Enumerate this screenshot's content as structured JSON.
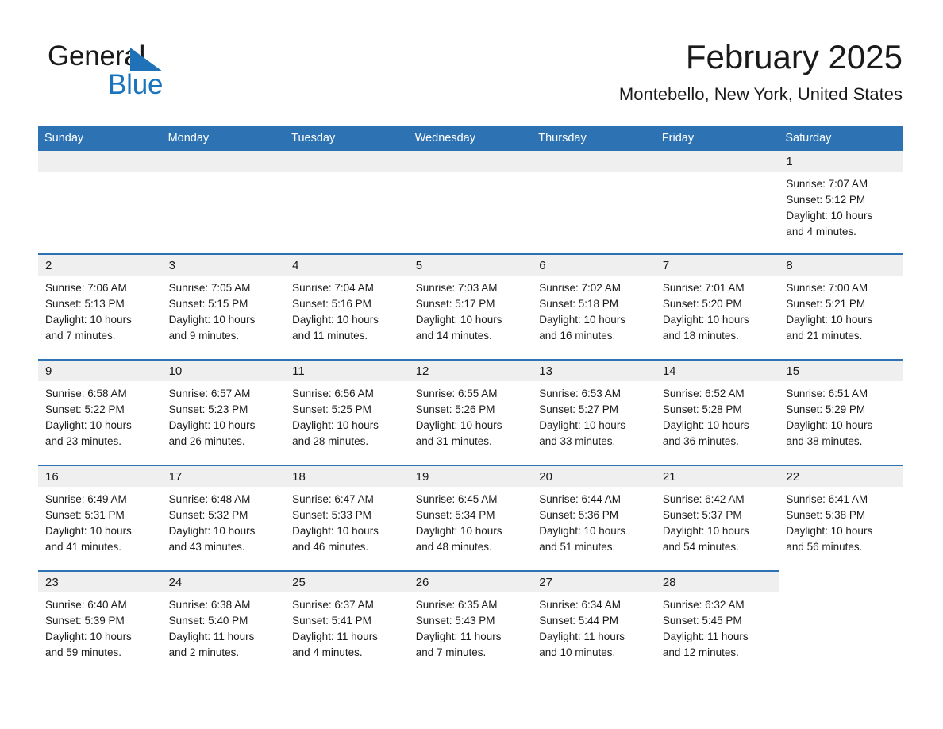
{
  "brand": {
    "name_part1": "General",
    "name_part2": "Blue",
    "triangle_color": "#1f72b8",
    "blue_color": "#1a74bd"
  },
  "header": {
    "title": "February 2025",
    "subtitle": "Montebello, New York, United States"
  },
  "theme": {
    "header_blue": "#2d72b2",
    "daynum_band": "#efefef",
    "text": "#1a1a1a"
  },
  "columns": [
    "Sunday",
    "Monday",
    "Tuesday",
    "Wednesday",
    "Thursday",
    "Friday",
    "Saturday"
  ],
  "weeks": [
    {
      "days": [
        {
          "date": "",
          "sunrise": "",
          "sunset": "",
          "daylight_line1": "",
          "daylight_line2": ""
        },
        {
          "date": "",
          "sunrise": "",
          "sunset": "",
          "daylight_line1": "",
          "daylight_line2": ""
        },
        {
          "date": "",
          "sunrise": "",
          "sunset": "",
          "daylight_line1": "",
          "daylight_line2": ""
        },
        {
          "date": "",
          "sunrise": "",
          "sunset": "",
          "daylight_line1": "",
          "daylight_line2": ""
        },
        {
          "date": "",
          "sunrise": "",
          "sunset": "",
          "daylight_line1": "",
          "daylight_line2": ""
        },
        {
          "date": "",
          "sunrise": "",
          "sunset": "",
          "daylight_line1": "",
          "daylight_line2": ""
        },
        {
          "date": "1",
          "sunrise": "Sunrise: 7:07 AM",
          "sunset": "Sunset: 5:12 PM",
          "daylight_line1": "Daylight: 10 hours",
          "daylight_line2": "and 4 minutes."
        }
      ]
    },
    {
      "days": [
        {
          "date": "2",
          "sunrise": "Sunrise: 7:06 AM",
          "sunset": "Sunset: 5:13 PM",
          "daylight_line1": "Daylight: 10 hours",
          "daylight_line2": "and 7 minutes."
        },
        {
          "date": "3",
          "sunrise": "Sunrise: 7:05 AM",
          "sunset": "Sunset: 5:15 PM",
          "daylight_line1": "Daylight: 10 hours",
          "daylight_line2": "and 9 minutes."
        },
        {
          "date": "4",
          "sunrise": "Sunrise: 7:04 AM",
          "sunset": "Sunset: 5:16 PM",
          "daylight_line1": "Daylight: 10 hours",
          "daylight_line2": "and 11 minutes."
        },
        {
          "date": "5",
          "sunrise": "Sunrise: 7:03 AM",
          "sunset": "Sunset: 5:17 PM",
          "daylight_line1": "Daylight: 10 hours",
          "daylight_line2": "and 14 minutes."
        },
        {
          "date": "6",
          "sunrise": "Sunrise: 7:02 AM",
          "sunset": "Sunset: 5:18 PM",
          "daylight_line1": "Daylight: 10 hours",
          "daylight_line2": "and 16 minutes."
        },
        {
          "date": "7",
          "sunrise": "Sunrise: 7:01 AM",
          "sunset": "Sunset: 5:20 PM",
          "daylight_line1": "Daylight: 10 hours",
          "daylight_line2": "and 18 minutes."
        },
        {
          "date": "8",
          "sunrise": "Sunrise: 7:00 AM",
          "sunset": "Sunset: 5:21 PM",
          "daylight_line1": "Daylight: 10 hours",
          "daylight_line2": "and 21 minutes."
        }
      ]
    },
    {
      "days": [
        {
          "date": "9",
          "sunrise": "Sunrise: 6:58 AM",
          "sunset": "Sunset: 5:22 PM",
          "daylight_line1": "Daylight: 10 hours",
          "daylight_line2": "and 23 minutes."
        },
        {
          "date": "10",
          "sunrise": "Sunrise: 6:57 AM",
          "sunset": "Sunset: 5:23 PM",
          "daylight_line1": "Daylight: 10 hours",
          "daylight_line2": "and 26 minutes."
        },
        {
          "date": "11",
          "sunrise": "Sunrise: 6:56 AM",
          "sunset": "Sunset: 5:25 PM",
          "daylight_line1": "Daylight: 10 hours",
          "daylight_line2": "and 28 minutes."
        },
        {
          "date": "12",
          "sunrise": "Sunrise: 6:55 AM",
          "sunset": "Sunset: 5:26 PM",
          "daylight_line1": "Daylight: 10 hours",
          "daylight_line2": "and 31 minutes."
        },
        {
          "date": "13",
          "sunrise": "Sunrise: 6:53 AM",
          "sunset": "Sunset: 5:27 PM",
          "daylight_line1": "Daylight: 10 hours",
          "daylight_line2": "and 33 minutes."
        },
        {
          "date": "14",
          "sunrise": "Sunrise: 6:52 AM",
          "sunset": "Sunset: 5:28 PM",
          "daylight_line1": "Daylight: 10 hours",
          "daylight_line2": "and 36 minutes."
        },
        {
          "date": "15",
          "sunrise": "Sunrise: 6:51 AM",
          "sunset": "Sunset: 5:29 PM",
          "daylight_line1": "Daylight: 10 hours",
          "daylight_line2": "and 38 minutes."
        }
      ]
    },
    {
      "days": [
        {
          "date": "16",
          "sunrise": "Sunrise: 6:49 AM",
          "sunset": "Sunset: 5:31 PM",
          "daylight_line1": "Daylight: 10 hours",
          "daylight_line2": "and 41 minutes."
        },
        {
          "date": "17",
          "sunrise": "Sunrise: 6:48 AM",
          "sunset": "Sunset: 5:32 PM",
          "daylight_line1": "Daylight: 10 hours",
          "daylight_line2": "and 43 minutes."
        },
        {
          "date": "18",
          "sunrise": "Sunrise: 6:47 AM",
          "sunset": "Sunset: 5:33 PM",
          "daylight_line1": "Daylight: 10 hours",
          "daylight_line2": "and 46 minutes."
        },
        {
          "date": "19",
          "sunrise": "Sunrise: 6:45 AM",
          "sunset": "Sunset: 5:34 PM",
          "daylight_line1": "Daylight: 10 hours",
          "daylight_line2": "and 48 minutes."
        },
        {
          "date": "20",
          "sunrise": "Sunrise: 6:44 AM",
          "sunset": "Sunset: 5:36 PM",
          "daylight_line1": "Daylight: 10 hours",
          "daylight_line2": "and 51 minutes."
        },
        {
          "date": "21",
          "sunrise": "Sunrise: 6:42 AM",
          "sunset": "Sunset: 5:37 PM",
          "daylight_line1": "Daylight: 10 hours",
          "daylight_line2": "and 54 minutes."
        },
        {
          "date": "22",
          "sunrise": "Sunrise: 6:41 AM",
          "sunset": "Sunset: 5:38 PM",
          "daylight_line1": "Daylight: 10 hours",
          "daylight_line2": "and 56 minutes."
        }
      ]
    },
    {
      "days": [
        {
          "date": "23",
          "sunrise": "Sunrise: 6:40 AM",
          "sunset": "Sunset: 5:39 PM",
          "daylight_line1": "Daylight: 10 hours",
          "daylight_line2": "and 59 minutes."
        },
        {
          "date": "24",
          "sunrise": "Sunrise: 6:38 AM",
          "sunset": "Sunset: 5:40 PM",
          "daylight_line1": "Daylight: 11 hours",
          "daylight_line2": "and 2 minutes."
        },
        {
          "date": "25",
          "sunrise": "Sunrise: 6:37 AM",
          "sunset": "Sunset: 5:41 PM",
          "daylight_line1": "Daylight: 11 hours",
          "daylight_line2": "and 4 minutes."
        },
        {
          "date": "26",
          "sunrise": "Sunrise: 6:35 AM",
          "sunset": "Sunset: 5:43 PM",
          "daylight_line1": "Daylight: 11 hours",
          "daylight_line2": "and 7 minutes."
        },
        {
          "date": "27",
          "sunrise": "Sunrise: 6:34 AM",
          "sunset": "Sunset: 5:44 PM",
          "daylight_line1": "Daylight: 11 hours",
          "daylight_line2": "and 10 minutes."
        },
        {
          "date": "28",
          "sunrise": "Sunrise: 6:32 AM",
          "sunset": "Sunset: 5:45 PM",
          "daylight_line1": "Daylight: 11 hours",
          "daylight_line2": "and 12 minutes."
        },
        {
          "date": "",
          "sunrise": "",
          "sunset": "",
          "daylight_line1": "",
          "daylight_line2": ""
        }
      ]
    }
  ]
}
